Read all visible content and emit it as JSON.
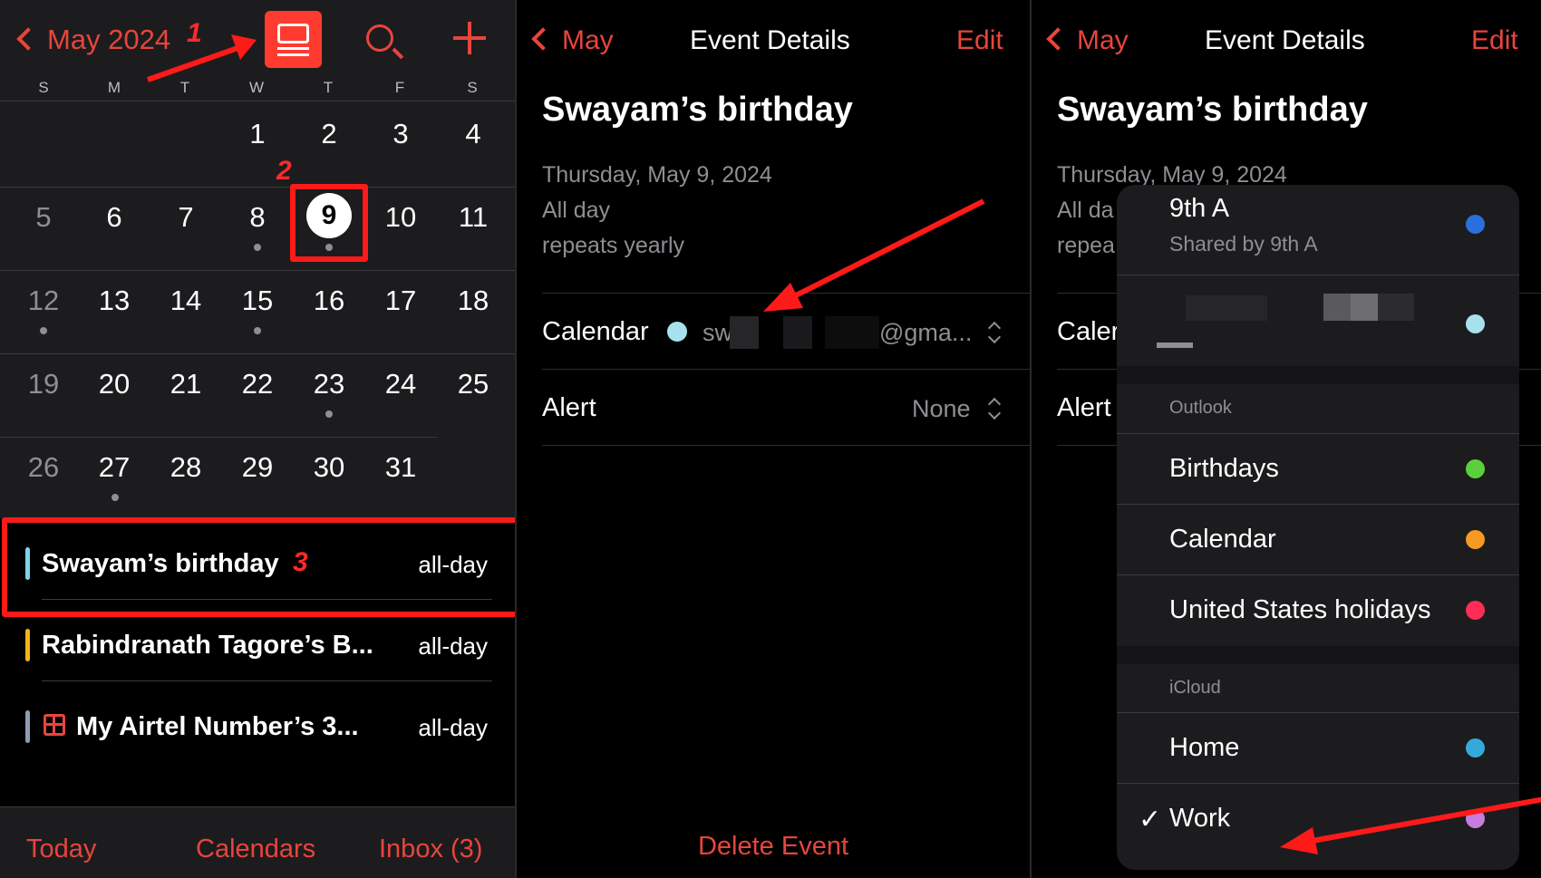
{
  "panel1": {
    "header": {
      "back_label": "May 2024"
    },
    "step_labels": [
      "1",
      "2",
      "3"
    ],
    "weekdays": [
      "S",
      "M",
      "T",
      "W",
      "T",
      "F",
      "S"
    ],
    "days": [
      "1",
      "2",
      "3",
      "4",
      "5",
      "6",
      "7",
      "8",
      "9",
      "10",
      "11",
      "12",
      "13",
      "14",
      "15",
      "16",
      "17",
      "18",
      "19",
      "20",
      "21",
      "22",
      "23",
      "24",
      "25",
      "26",
      "27",
      "28",
      "29",
      "30",
      "31"
    ],
    "events": [
      {
        "title": "Swayam’s birthday",
        "when": "all-day",
        "color": "#7fd3e6"
      },
      {
        "title": "Rabindranath Tagore’s B...",
        "when": "all-day",
        "color": "#f5b21a"
      },
      {
        "title": "My Airtel Number’s 3...",
        "when": "all-day",
        "color": "#8e9bb5"
      }
    ],
    "tabbar": {
      "today": "Today",
      "calendars": "Calendars",
      "inbox": "Inbox (3)"
    }
  },
  "panel2": {
    "back_label": "May",
    "nav_title": "Event Details",
    "edit_label": "Edit",
    "event_title": "Swayam’s birthday",
    "date": "Thursday, May 9, 2024",
    "all_day": "All day",
    "repeats": "repeats yearly",
    "calendar_label": "Calendar",
    "calendar_value_start": "sw",
    "calendar_value_end": "@gma...",
    "calendar_dot_color": "#a8e1ee",
    "alert_label": "Alert",
    "alert_value": "None",
    "delete_label": "Delete Event"
  },
  "panel3": {
    "back_label": "May",
    "nav_title": "Event Details",
    "edit_label": "Edit",
    "event_title": "Swayam’s birthday",
    "date_partial": "Thursday, May 9, 2024",
    "all_day_partial": "All da",
    "repeats_partial": "repea",
    "calendar_partial": "Caler",
    "alert_label": "Alert",
    "menu": {
      "top_item": {
        "label": "9th A",
        "sub": "Shared by 9th A",
        "color": "#2a6fdb"
      },
      "second_item_color": "#a8e1ee",
      "sections": [
        {
          "header": "Outlook",
          "items": [
            {
              "label": "Birthdays",
              "color": "#5ad13b"
            },
            {
              "label": "Calendar",
              "color": "#f59a23"
            },
            {
              "label": "United States holidays",
              "color": "#ff2d55"
            }
          ]
        },
        {
          "header": "iCloud",
          "items": [
            {
              "label": "Home",
              "color": "#34aadc"
            },
            {
              "label": "Work",
              "color": "#c77dde",
              "checked": true
            }
          ]
        }
      ],
      "check_mark": "✓"
    }
  },
  "colors": {
    "accent": "#e8453c",
    "annotation_red": "#ff1a1a"
  }
}
